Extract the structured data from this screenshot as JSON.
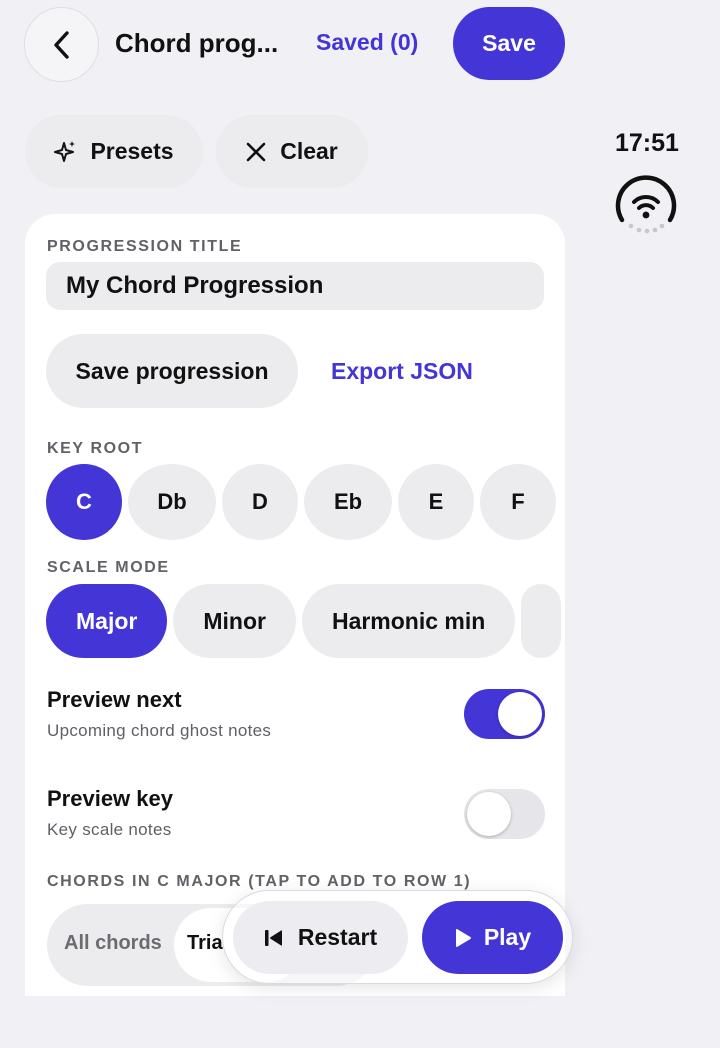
{
  "colors": {
    "accent": "#4335d6",
    "pill": "#ececef",
    "background": "#f0f0f5"
  },
  "header": {
    "back_icon": "chevron-left-icon",
    "title": "Chord prog...",
    "saved_label": "Saved (0)",
    "save_label": "Save"
  },
  "actions": {
    "presets_icon": "sparkle-icon",
    "presets_label": "Presets",
    "clear_icon": "close-icon",
    "clear_label": "Clear"
  },
  "status": {
    "time": "17:51",
    "wifi_icon": "wifi-icon"
  },
  "card": {
    "title_label": "PROGRESSION TITLE",
    "title_value": "My Chord Progression",
    "save_progression_label": "Save progression",
    "export_label": "Export JSON",
    "key_root_label": "KEY ROOT",
    "key_roots": [
      "C",
      "Db",
      "D",
      "Eb",
      "E",
      "F"
    ],
    "selected_key": "C",
    "scale_mode_label": "SCALE MODE",
    "scale_modes": [
      "Major",
      "Minor",
      "Harmonic min"
    ],
    "selected_mode": "Major",
    "preview_next": {
      "title": "Preview next",
      "subtitle": "Upcoming chord ghost notes",
      "on": true
    },
    "preview_key": {
      "title": "Preview key",
      "subtitle": "Key scale notes",
      "on": false
    },
    "chords_label": "CHORDS IN C MAJOR (TAP TO ADD TO ROW 1)",
    "filter_all": "All chords",
    "filter_triads": "Tria"
  },
  "transport": {
    "restart_icon": "skip-back-icon",
    "restart_label": "Restart",
    "play_icon": "play-icon",
    "play_label": "Play"
  }
}
